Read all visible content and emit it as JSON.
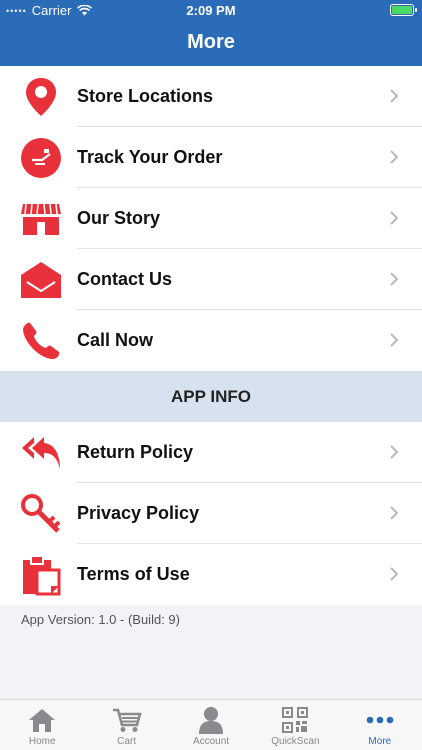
{
  "status_bar": {
    "carrier": "Carrier",
    "time": "2:09 PM"
  },
  "header": {
    "title": "More"
  },
  "menu": [
    {
      "label": "Store Locations",
      "icon": "map-pin-icon"
    },
    {
      "label": "Track Your Order",
      "icon": "truck-icon"
    },
    {
      "label": "Our Story",
      "icon": "storefront-icon"
    },
    {
      "label": "Contact Us",
      "icon": "envelope-icon"
    },
    {
      "label": "Call Now",
      "icon": "phone-icon"
    }
  ],
  "section_header": "APP INFO",
  "app_info": [
    {
      "label": "Return Policy",
      "icon": "reply-all-icon"
    },
    {
      "label": "Privacy Policy",
      "icon": "key-icon"
    },
    {
      "label": "Terms of Use",
      "icon": "clipboard-icon"
    }
  ],
  "version_text": "App Version: 1.0 - (Build: 9)",
  "tabs": [
    {
      "label": "Home",
      "icon": "home-icon"
    },
    {
      "label": "Cart",
      "icon": "cart-icon"
    },
    {
      "label": "Account",
      "icon": "account-icon"
    },
    {
      "label": "QuickScan",
      "icon": "qr-code-icon"
    },
    {
      "label": "More",
      "icon": "more-dots-icon",
      "active": true
    }
  ],
  "colors": {
    "brand": "#2b6cb8",
    "accent": "#e8313a",
    "section_bg": "#d6e3ef"
  }
}
